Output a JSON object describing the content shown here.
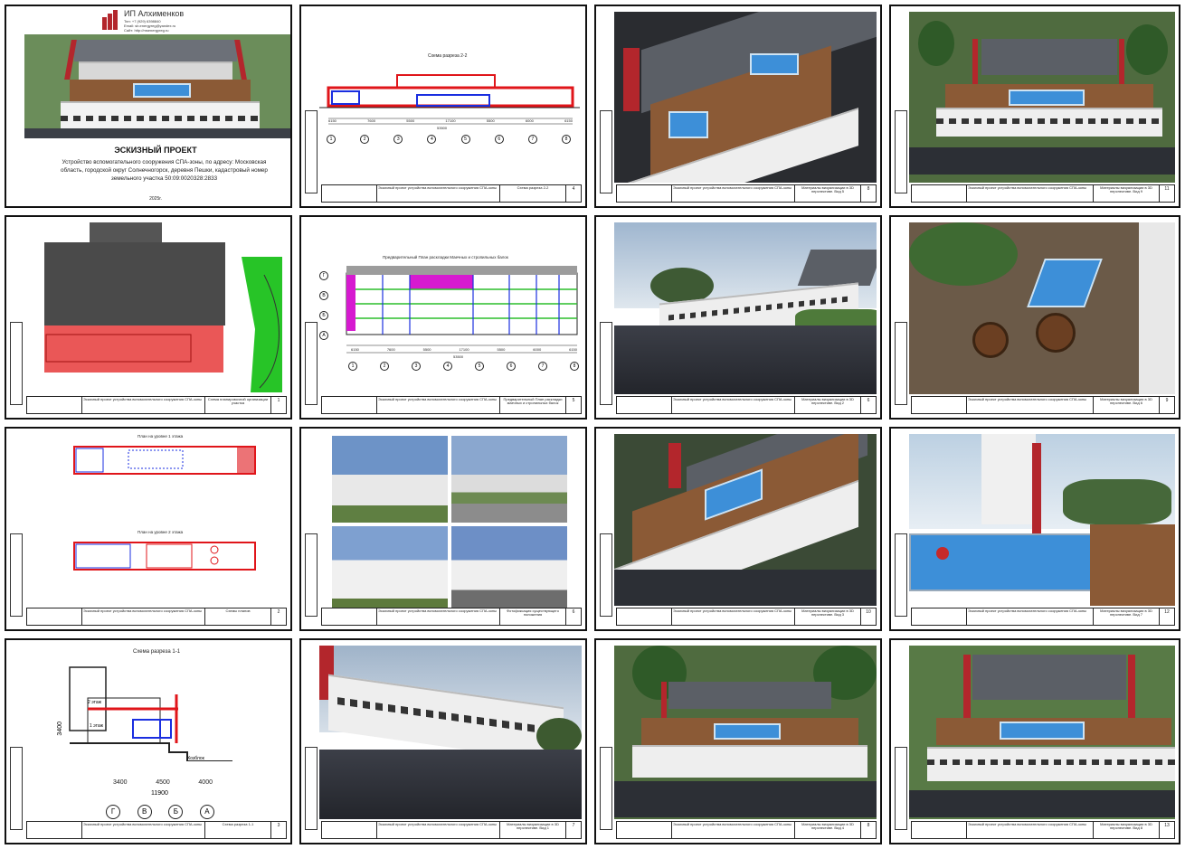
{
  "sheet1": {
    "company": "ИП Алхименков",
    "contacts": [
      "Тел: +7 (929) 6398840",
      "Email: sb.energyreg@yandex.ru",
      "Сайт: http://msenergyreg.ru"
    ],
    "title": "ЭСКИЗНЫЙ ПРОЕКТ",
    "subtitle": "Устройство вспомогательного сооружения СПА-зоны, по адресу: Московская область, городской округ Солнечногорск, деревня Пешки, кадастровый номер земельного участка 50:09:0020328:2833",
    "year": "2025г."
  },
  "sheet_section22": {
    "title": "Схема разреза 2-2",
    "dims": [
      "6150",
      "7600",
      "5500",
      "17100",
      "5500",
      "6000",
      "6150"
    ],
    "total": "53500",
    "axes": [
      "1",
      "2",
      "3",
      "4",
      "5",
      "6",
      "7",
      "8"
    ]
  },
  "sheet_roofplan": {
    "title": "Предварительный План раскладки Маечных и стропильных балок",
    "dims": [
      "6150",
      "7600",
      "5500",
      "17100",
      "5500",
      "6000",
      "6150"
    ],
    "total": "53500",
    "axes": [
      "1",
      "2",
      "3",
      "4",
      "5",
      "6",
      "7",
      "8"
    ],
    "row_axes": [
      "Г",
      "В",
      "Б",
      "А"
    ]
  },
  "sheet_plans": {
    "title1": "План на уровне 1 этажа",
    "title2": "План на уровне 2 этажа"
  },
  "sheet_section11": {
    "title": "Схема разреза 1-1",
    "labels": [
      "2 этаж",
      "1 этаж",
      "Хозблок"
    ],
    "height": "3400",
    "dims": [
      "3400",
      "4500",
      "4000"
    ],
    "total": "11900",
    "axes": [
      "Г",
      "В",
      "Б",
      "А"
    ]
  },
  "stamps": [
    {
      "desc": "Эскизный проект устройства вспомогательного сооружения СПА-зоны, по адресу: Московская область, городской округ Солнечногорск, деревня Пешки",
      "name": "",
      "page": "1"
    },
    {
      "desc": "Эскизный проект устройства вспомогательного сооружения СПА-зоны",
      "name": "Схема разреза 2-2",
      "page": "4"
    },
    {
      "desc": "Эскизный проект устройства вспомогательного сооружения СПА-зоны",
      "name": "Материалы визуализации в 3D перспективе. Вид 5",
      "page": "8"
    },
    {
      "desc": "Эскизный проект устройства вспомогательного сооружения СПА-зоны",
      "name": "Материалы визуализации в 3D перспективе. Вид 9",
      "page": "11"
    },
    {
      "desc": "Эскизный проект устройства вспомогательного сооружения СПА-зоны",
      "name": "Схема планировочной организации участка",
      "page": "1"
    },
    {
      "desc": "Эскизный проект устройства вспомогательного сооружения СПА-зоны",
      "name": "Предварительный План раскладки маечных и стропильных балок",
      "page": "5"
    },
    {
      "desc": "Эскизный проект устройства вспомогательного сооружения СПА-зоны",
      "name": "Материалы визуализации в 3D перспективе. Вид 2",
      "page": "6"
    },
    {
      "desc": "Эскизный проект устройства вспомогательного сооружения СПА-зоны",
      "name": "Материалы визуализации в 3D перспективе. Вид 6",
      "page": "9"
    },
    {
      "desc": "Эскизный проект устройства вспомогательного сооружения СПА-зоны",
      "name": "Схемы планов",
      "page": "2"
    },
    {
      "desc": "Эскизный проект устройства вспомогательного сооружения СПА-зоны",
      "name": "Фотофиксация существующего положения",
      "page": "6"
    },
    {
      "desc": "Эскизный проект устройства вспомогательного сооружения СПА-зоны",
      "name": "Материалы визуализации в 3D перспективе. Вид 3",
      "page": "10"
    },
    {
      "desc": "Эскизный проект устройства вспомогательного сооружения СПА-зоны",
      "name": "Материалы визуализации в 3D перспективе. Вид 7",
      "page": "12"
    },
    {
      "desc": "Эскизный проект устройства вспомогательного сооружения СПА-зоны",
      "name": "Схема разреза 1-1",
      "page": "3"
    },
    {
      "desc": "Эскизный проект устройства вспомогательного сооружения СПА-зоны",
      "name": "Материалы визуализации в 3D перспективе. Вид 1",
      "page": "7"
    },
    {
      "desc": "Эскизный проект устройства вспомогательного сооружения СПА-зоны",
      "name": "Материалы визуализации в 3D перспективе. Вид 4",
      "page": "8"
    },
    {
      "desc": "Эскизный проект устройства вспомогательного сооружения СПА-зоны",
      "name": "Материалы визуализации в 3D перспективе. Вид 8",
      "page": "13"
    }
  ]
}
